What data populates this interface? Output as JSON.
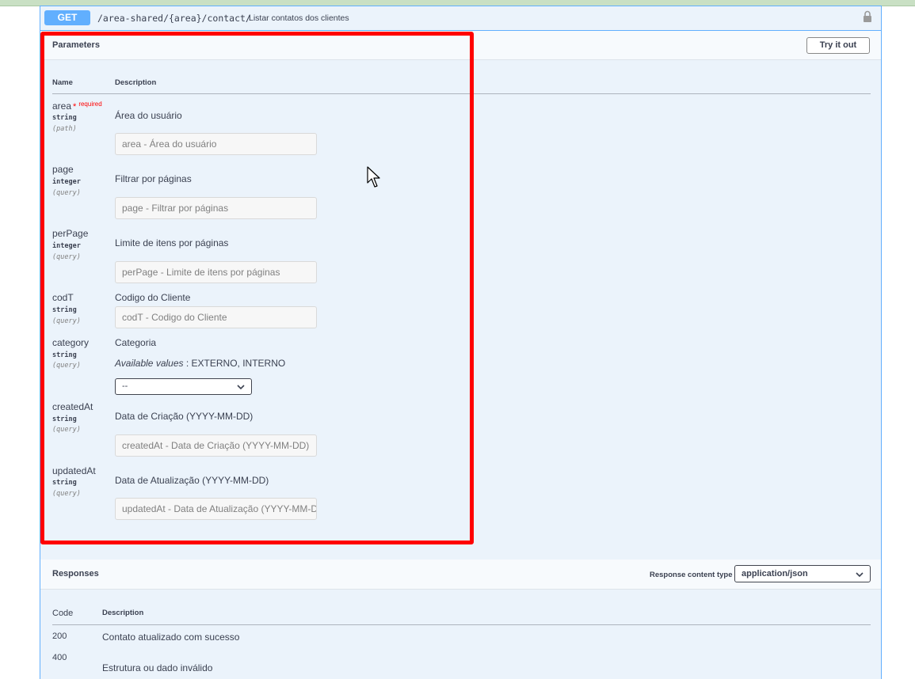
{
  "endpoint": {
    "method": "GET",
    "path": "/area-shared/{area}/contact/",
    "summary": "Listar contatos dos clientes"
  },
  "parameters": {
    "title": "Parameters",
    "try_button": "Try it out",
    "col_name": "Name",
    "col_description": "Description",
    "required_label": "required",
    "required_star": "*",
    "items": [
      {
        "name": "area",
        "type": "string",
        "in": "(path)",
        "description": "Área do usuário",
        "placeholder": "area - Área do usuário",
        "required": true
      },
      {
        "name": "page",
        "type": "integer",
        "in": "(query)",
        "description": "Filtrar por páginas",
        "placeholder": "page - Filtrar por páginas"
      },
      {
        "name": "perPage",
        "type": "integer",
        "in": "(query)",
        "description": "Limite de itens por páginas",
        "placeholder": "perPage - Limite de itens por páginas"
      },
      {
        "name": "codT",
        "type": "string",
        "in": "(query)",
        "description": "Codigo do Cliente",
        "placeholder": "codT - Codigo do Cliente"
      },
      {
        "name": "category",
        "type": "string",
        "in": "(query)",
        "description": "Categoria",
        "available_label": "Available values",
        "available_values": ": EXTERNO, INTERNO",
        "select_value": "--"
      },
      {
        "name": "createdAt",
        "type": "string",
        "in": "(query)",
        "description": "Data de Criação (YYYY-MM-DD)",
        "placeholder": "createdAt - Data de Criação (YYYY-MM-DD)"
      },
      {
        "name": "updatedAt",
        "type": "string",
        "in": "(query)",
        "description": "Data de Atualização (YYYY-MM-DD)",
        "placeholder": "updatedAt - Data de Atualização (YYYY-MM-DD)"
      }
    ]
  },
  "responses": {
    "title": "Responses",
    "content_type_label": "Response content type",
    "content_type_value": "application/json",
    "col_code": "Code",
    "col_description": "Description",
    "items": [
      {
        "code": "200",
        "description": "Contato atualizado com sucesso"
      },
      {
        "code": "400",
        "description": "Estrutura ou dado inválido"
      }
    ]
  },
  "colors": {
    "get_blue": "#61affe",
    "panel_bg": "#ebf3fb",
    "highlight_red": "#ff0000"
  }
}
